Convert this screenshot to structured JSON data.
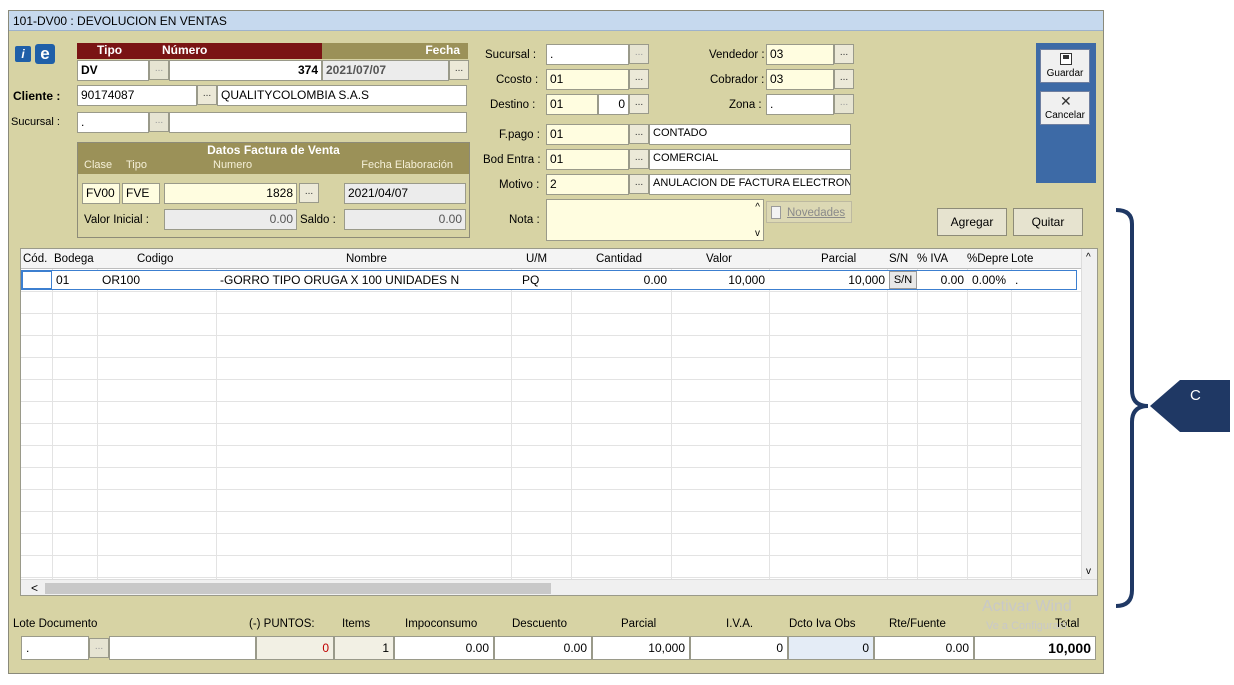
{
  "window": {
    "title": "101-DV00 : DEVOLUCION EN VENTAS"
  },
  "header": {
    "tipo_label": "Tipo",
    "numero_label": "Número",
    "fecha_label": "Fecha",
    "tipo_value": "DV",
    "numero_value": "374",
    "fecha_value": "2021/07/07",
    "cliente_label": "Cliente :",
    "cliente_code": "90174087",
    "cliente_name": "QUALITYCOLOMBIA S.A.S",
    "sucursal_label": "Sucursal :",
    "sucursal_value": "."
  },
  "datos_factura": {
    "title": "Datos Factura de Venta",
    "clase_label": "Clase",
    "tipo_label": "Tipo",
    "numero_label": "Numero",
    "fecha_label": "Fecha Elaboración",
    "clase_value": "FV00",
    "tipo_value": "FVE",
    "numero_value": "1828",
    "fecha_value": "2021/04/07",
    "valor_inicial_label": "Valor Inicial :",
    "valor_inicial_value": "0.00",
    "saldo_label": "Saldo :",
    "saldo_value": "0.00"
  },
  "middle": {
    "sucursal_label": "Sucursal :",
    "sucursal_value": ".",
    "ccosto_label": "Ccosto :",
    "ccosto_value": "01",
    "destino_label": "Destino :",
    "destino_value": "01",
    "destino_num": "0",
    "vendedor_label": "Vendedor :",
    "vendedor_value": "03",
    "cobrador_label": "Cobrador :",
    "cobrador_value": "03",
    "zona_label": "Zona :",
    "zona_value": ".",
    "fpago_label": "F.pago :",
    "fpago_code": "01",
    "fpago_desc": "CONTADO",
    "bodentra_label": "Bod Entra :",
    "bodentra_code": "01",
    "bodentra_desc": "COMERCIAL",
    "motivo_label": "Motivo :",
    "motivo_code": "2",
    "motivo_desc": "ANULACION DE FACTURA ELECTRON",
    "nota_label": "Nota :",
    "novedades_label": "Novedades"
  },
  "toolbar": {
    "guardar_label": "Guardar",
    "cancelar_label": "Cancelar",
    "agregar_label": "Agregar",
    "quitar_label": "Quitar"
  },
  "grid": {
    "columns": [
      "Cód.",
      "Bodega",
      "Codigo",
      "Nombre",
      "U/M",
      "Cantidad",
      "Valor",
      "Parcial",
      "S/N",
      "% IVA",
      "%Depre",
      "Lote"
    ],
    "rows": [
      {
        "bodega": "01",
        "codigo": "OR100",
        "nombre": "-GORRO TIPO ORUGA X 100 UNIDADES N",
        "um": "PQ",
        "cantidad": "0.00",
        "valor": "10,000",
        "parcial": "10,000",
        "sn": "S/N",
        "iva": "0.00",
        "depre": "0.00%",
        "lote": "."
      }
    ]
  },
  "footer": {
    "lote_doc_label": "Lote Documento",
    "lote_value": ".",
    "puntos_label": "(-) PUNTOS:",
    "puntos_value": "0",
    "items_label": "Items",
    "items_value": "1",
    "impoconsumo_label": "Impoconsumo",
    "impoconsumo_value": "0.00",
    "descuento_label": "Descuento",
    "descuento_value": "0.00",
    "parcial_label": "Parcial",
    "parcial_value": "10,000",
    "iva_label": "I.V.A.",
    "iva_value": "0",
    "dcto_label": "Dcto Iva Obs",
    "dcto_value": "0",
    "rte_label": "Rte/Fuente",
    "rte_value": "0.00",
    "total_label": "Total",
    "total_value": "10,000"
  },
  "annotation": {
    "callout_label": "C"
  },
  "watermark": {
    "line1": "Activar Wind",
    "line2": "Ve a Configuraci"
  },
  "colors": {
    "window_bg": "#d7d3a4",
    "header_red": "#7a1414",
    "callout": "#1f3864",
    "toolbar_blue": "#3d6aa6"
  }
}
